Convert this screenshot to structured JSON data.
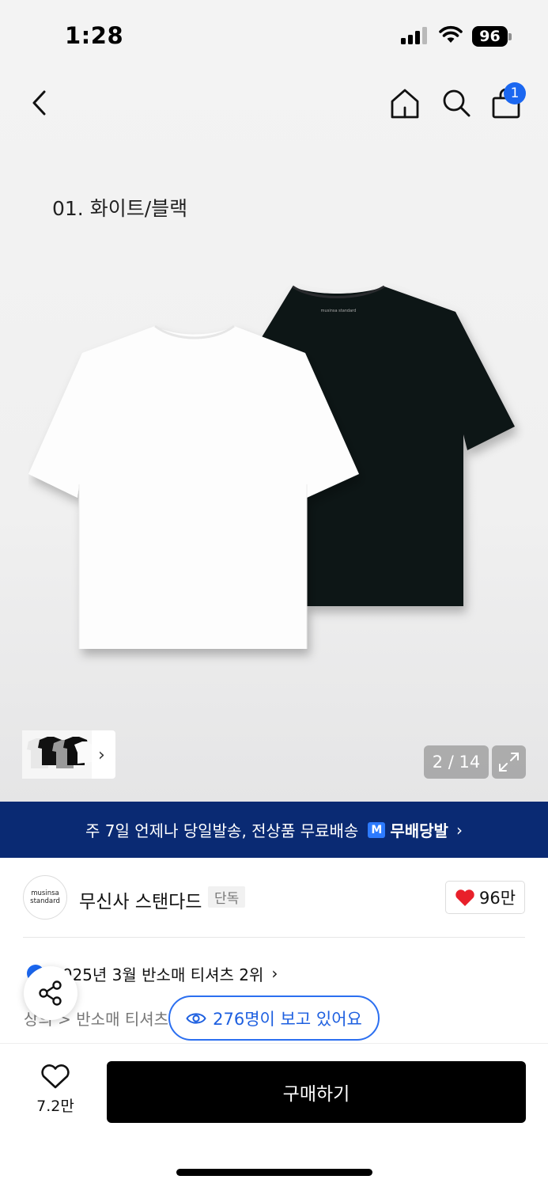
{
  "status_bar": {
    "time": "1:28",
    "battery": "96"
  },
  "nav": {
    "cart_count": "1"
  },
  "gallery": {
    "option_caption": "01. 화이트/블랙",
    "counter": "2 / 14",
    "shirt_brand_print": "musinsa standard"
  },
  "shipping": {
    "text": "주 7일 언제나 당일발송, 전상품 무료배송",
    "badge_mark": "M",
    "badge_label": "무배당발"
  },
  "brand": {
    "logo_line1": "musinsa",
    "logo_line2": "standard",
    "name": "무신사 스탠다드",
    "tag": "단독",
    "likes": "96만"
  },
  "ranking": {
    "text": "2025년 3월 반소매 티셔츠 2위",
    "category": "상의 > 반소매 티셔츠"
  },
  "viewers": {
    "text": "276명이 보고 있어요"
  },
  "bottom": {
    "wish_count": "7.2만",
    "buy_label": "구매하기"
  },
  "colors": {
    "brand_blue": "#1b67f0",
    "banner_navy": "#0a2a73",
    "heart_red": "#e8202a",
    "buy_black": "#000000"
  }
}
